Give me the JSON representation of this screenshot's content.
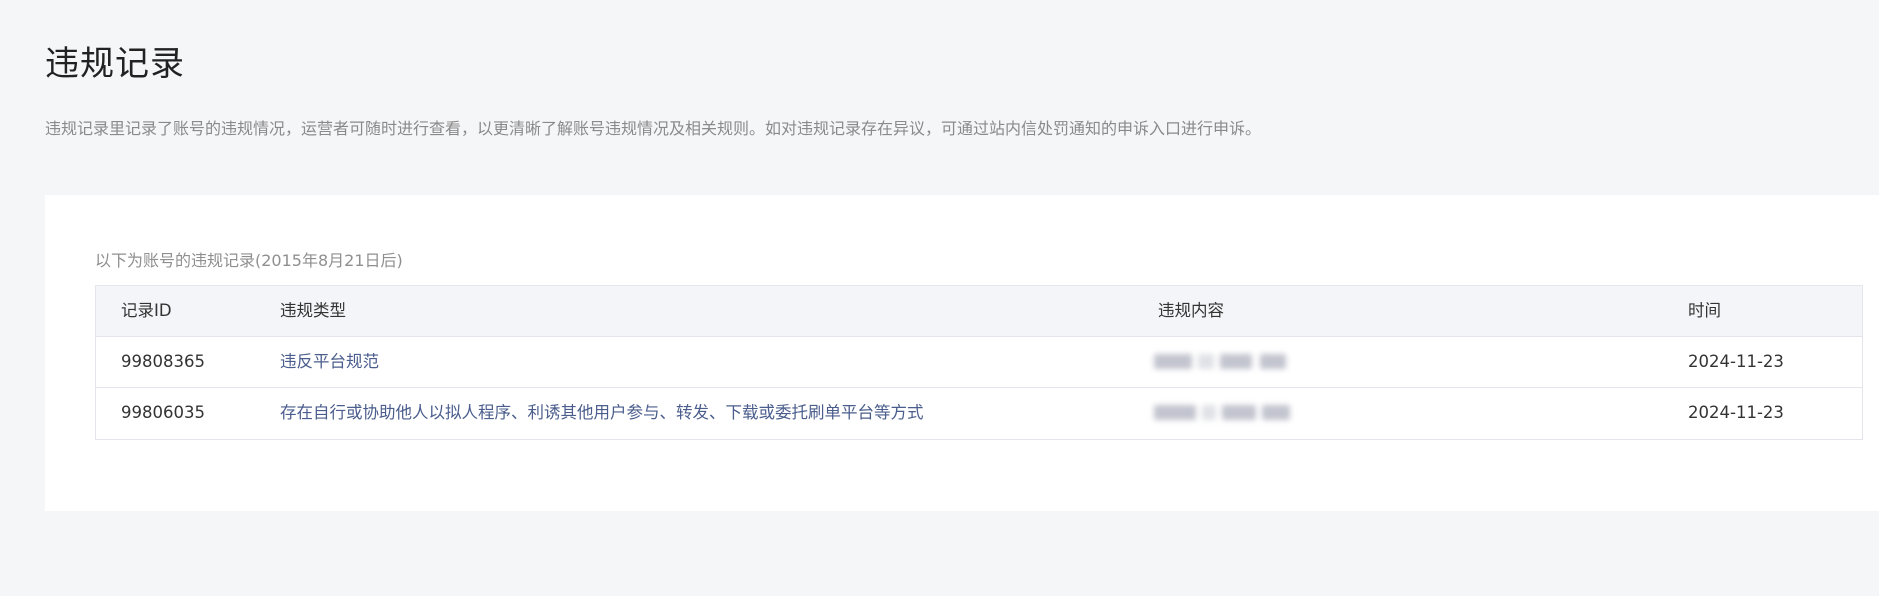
{
  "page": {
    "title": "违规记录",
    "description": "违规记录里记录了账号的违规情况，运营者可随时进行查看，以更清晰了解账号违规情况及相关规则。如对违规记录存在异议，可通过站内信处罚通知的申诉入口进行申诉。"
  },
  "records": {
    "caption": "以下为账号的违规记录(2015年8月21日后)",
    "columns": {
      "id": "记录ID",
      "type": "违规类型",
      "content": "违规内容",
      "time": "时间"
    },
    "rows": [
      {
        "id": "99808365",
        "type": "违反平台规范",
        "content_redacted": true,
        "time": "2024-11-23"
      },
      {
        "id": "99806035",
        "type": "存在自行或协助他人以拟人程序、利诱其他用户参与、转发、下载或委托刷单平台等方式",
        "content_redacted": true,
        "time": "2024-11-23"
      }
    ]
  },
  "colors": {
    "link": "#4a5d8c",
    "header_bg": "#f4f5f9",
    "page_bg": "#f5f6f8",
    "border": "#e4e6eb"
  }
}
